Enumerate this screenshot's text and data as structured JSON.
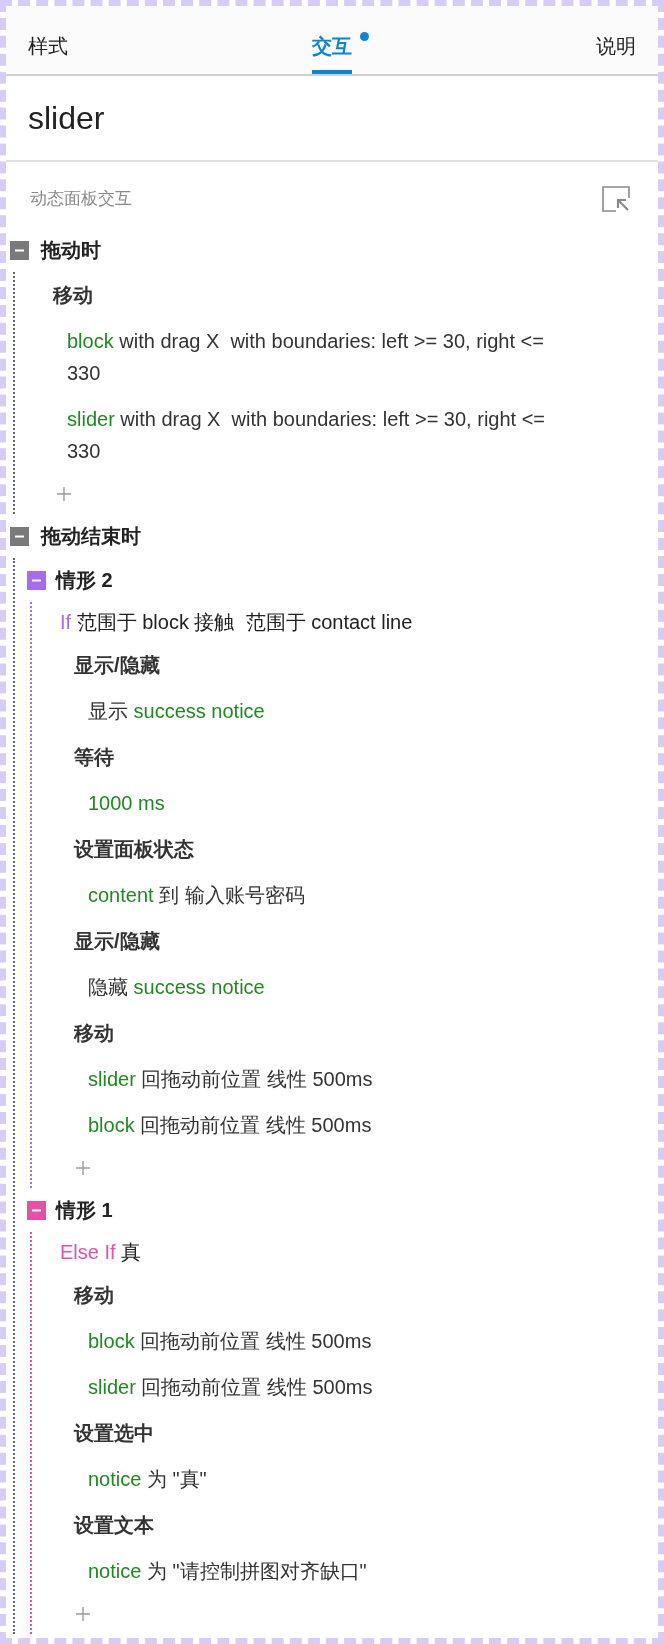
{
  "tabs": [
    {
      "label": "样式",
      "selected": false,
      "modified": false
    },
    {
      "label": "交互",
      "selected": true,
      "modified": true
    },
    {
      "label": "说明",
      "selected": false,
      "modified": false
    }
  ],
  "title": "slider",
  "section": {
    "label": "动态面板交互"
  },
  "events": [
    {
      "name": "拖动时",
      "expanded": true,
      "actions": [
        {
          "name": "移动",
          "lines": [
            {
              "segments": [
                {
                  "kind": "name",
                  "text": "block"
                },
                {
                  "kind": "plain",
                  "text": " with drag X  with boundaries: left >= 30, right <= 330"
                }
              ]
            },
            {
              "segments": [
                {
                  "kind": "name",
                  "text": "slider"
                },
                {
                  "kind": "plain",
                  "text": " with drag X  with boundaries: left >= 30, right <= 330"
                }
              ]
            }
          ]
        }
      ]
    },
    {
      "name": "拖动结束时",
      "expanded": true,
      "cases": [
        {
          "name": "情形 2",
          "color": "#a66cf0",
          "expanded": true,
          "keyword": "If",
          "condition": "范围于 block 接触  范围于 contact line",
          "actions": [
            {
              "name": "显示/隐藏",
              "lines": [
                {
                  "segments": [
                    {
                      "kind": "plain",
                      "text": "显示 "
                    },
                    {
                      "kind": "name",
                      "text": "success notice"
                    }
                  ]
                }
              ]
            },
            {
              "name": "等待",
              "lines": [
                {
                  "segments": [
                    {
                      "kind": "name",
                      "text": "1000 ms"
                    }
                  ]
                }
              ]
            },
            {
              "name": "设置面板状态",
              "lines": [
                {
                  "segments": [
                    {
                      "kind": "name",
                      "text": "content"
                    },
                    {
                      "kind": "plain",
                      "text": " 到 输入账号密码"
                    }
                  ]
                }
              ]
            },
            {
              "name": "显示/隐藏",
              "lines": [
                {
                  "segments": [
                    {
                      "kind": "plain",
                      "text": "隐藏 "
                    },
                    {
                      "kind": "name",
                      "text": "success notice"
                    }
                  ]
                }
              ]
            },
            {
              "name": "移动",
              "lines": [
                {
                  "segments": [
                    {
                      "kind": "name",
                      "text": "slider"
                    },
                    {
                      "kind": "plain",
                      "text": " 回拖动前位置 线性 500ms"
                    }
                  ]
                },
                {
                  "segments": [
                    {
                      "kind": "name",
                      "text": "block"
                    },
                    {
                      "kind": "plain",
                      "text": " 回拖动前位置 线性 500ms"
                    }
                  ]
                }
              ]
            }
          ]
        },
        {
          "name": "情形 1",
          "color": "#e94fa6",
          "expanded": true,
          "keyword": "Else If",
          "condition": "真",
          "actions": [
            {
              "name": "移动",
              "lines": [
                {
                  "segments": [
                    {
                      "kind": "name",
                      "text": "block"
                    },
                    {
                      "kind": "plain",
                      "text": " 回拖动前位置 线性 500ms"
                    }
                  ]
                },
                {
                  "segments": [
                    {
                      "kind": "name",
                      "text": "slider"
                    },
                    {
                      "kind": "plain",
                      "text": " 回拖动前位置 线性 500ms"
                    }
                  ]
                }
              ]
            },
            {
              "name": "设置选中",
              "lines": [
                {
                  "segments": [
                    {
                      "kind": "name",
                      "text": "notice"
                    },
                    {
                      "kind": "plain",
                      "text": " 为 \"真\""
                    }
                  ]
                }
              ]
            },
            {
              "name": "设置文本",
              "lines": [
                {
                  "segments": [
                    {
                      "kind": "name",
                      "text": "notice"
                    },
                    {
                      "kind": "plain",
                      "text": " 为 \"请控制拼图对齐缺口\""
                    }
                  ]
                }
              ]
            }
          ]
        }
      ]
    }
  ]
}
